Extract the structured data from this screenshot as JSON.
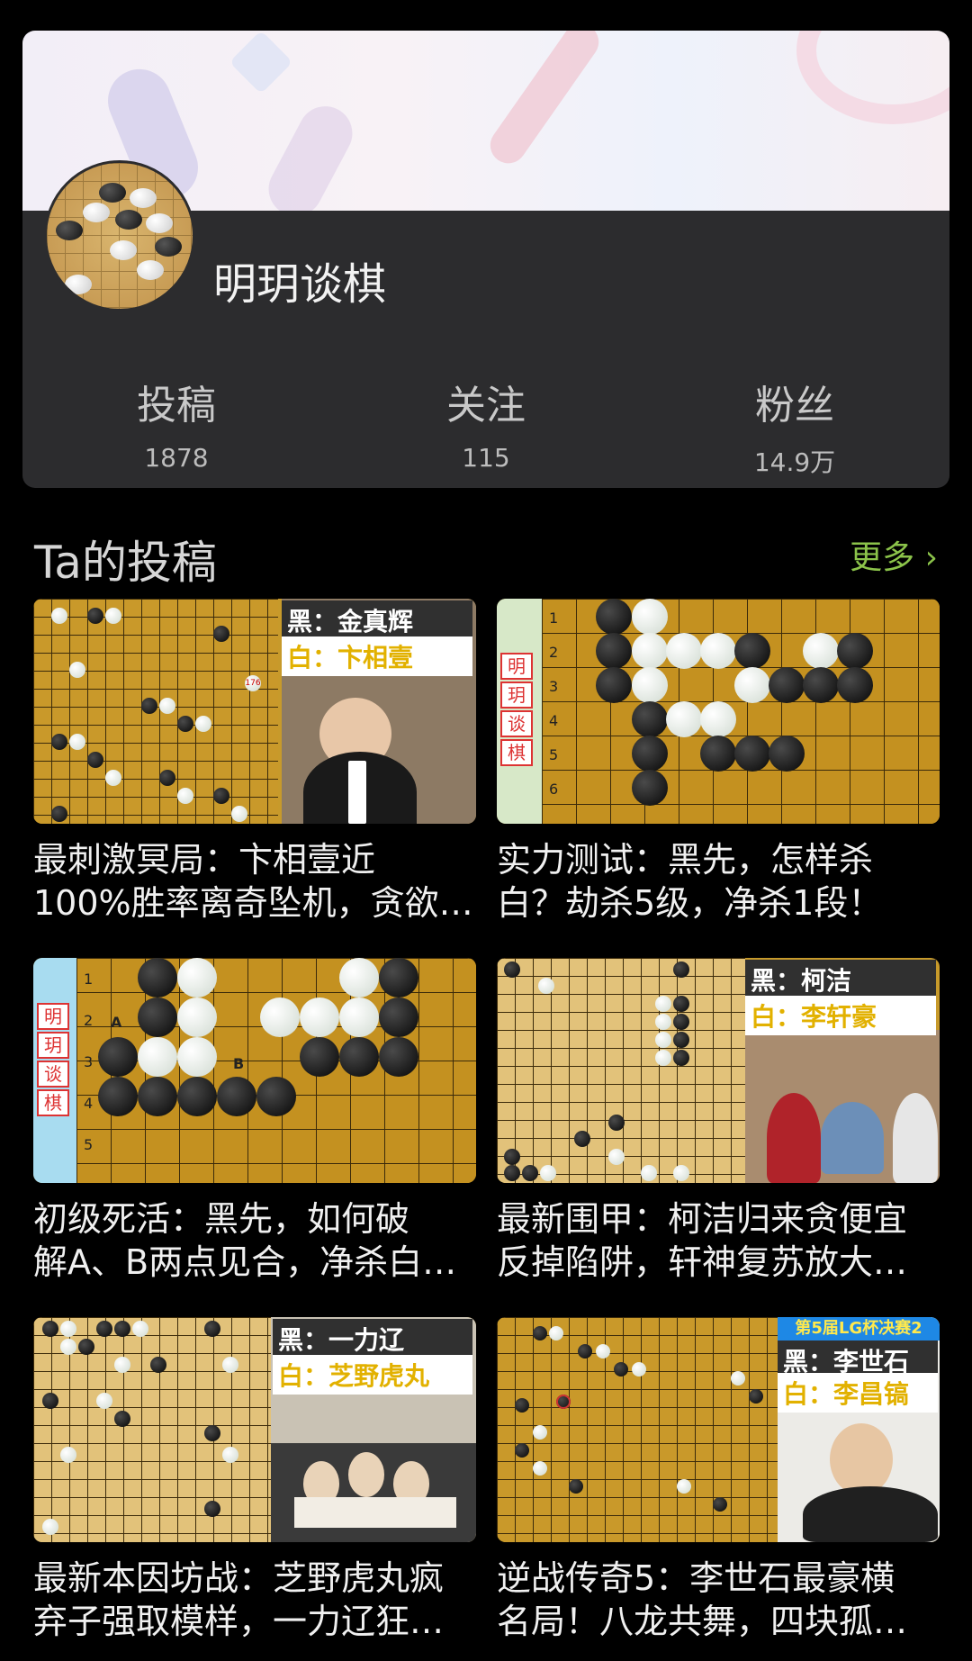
{
  "profile": {
    "name": "明玥谈棋",
    "stats": [
      {
        "label": "投稿",
        "value": "1878"
      },
      {
        "label": "关注",
        "value": "115"
      },
      {
        "label": "粉丝",
        "value": "14.9万"
      }
    ]
  },
  "section": {
    "title": "Ta的投稿",
    "more_label": "更多 ›"
  },
  "videos": [
    {
      "title_line1": "最刺激冥局：卞相壹近",
      "title_line2": "100%胜率离奇坠机，贪欲…",
      "black_tag": "黑：金真辉",
      "white_tag": "白：卞相壹",
      "move_mark": "176"
    },
    {
      "title_line1": "实力测试：黑先，怎样杀",
      "title_line2": "白？劫杀5级，净杀1段！",
      "stamp": [
        "明",
        "玥",
        "谈",
        "棋"
      ],
      "rows": [
        "1",
        "2",
        "3",
        "4",
        "5",
        "6"
      ]
    },
    {
      "title_line1": "初级死活：黑先，如何破",
      "title_line2": "解A、B两点见合，净杀白…",
      "stamp": [
        "明",
        "玥",
        "谈",
        "棋"
      ],
      "rows": [
        "1",
        "2",
        "3",
        "4",
        "5"
      ],
      "point_a": "A",
      "point_b": "B"
    },
    {
      "title_line1": "最新围甲：柯洁归来贪便宜",
      "title_line2": "反掉陷阱，轩神复苏放大…",
      "black_tag": "黑：柯洁",
      "white_tag": "白：李轩豪"
    },
    {
      "title_line1": "最新本因坊战：芝野虎丸疯",
      "title_line2": "弃子强取模样，一力辽狂…",
      "black_tag": "黑：一力辽",
      "white_tag": "白：芝野虎丸"
    },
    {
      "title_line1": "逆战传奇5：李世石最豪横",
      "title_line2": "名局！八龙共舞，四块孤…",
      "event_tag": "第5届LG杯决赛2",
      "black_tag": "黑：李世石",
      "white_tag": "白：李昌镐"
    }
  ]
}
